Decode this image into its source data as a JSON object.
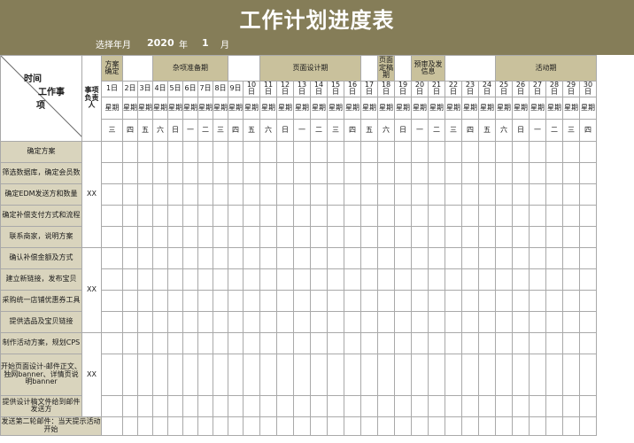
{
  "title": "工作计划进度表",
  "select_label": "选择年月",
  "year_value": "2020",
  "year_unit": "年",
  "month_value": "1",
  "month_unit": "月",
  "corner": {
    "line1": "时间",
    "line2": "工作事",
    "line3": "项"
  },
  "owner_header": "事项负责人",
  "phases": [
    {
      "label": "方案确定",
      "span": 1,
      "shaded": true
    },
    {
      "label": "",
      "span": 2,
      "shaded": false
    },
    {
      "label": "杂项准备期",
      "span": 5,
      "shaded": true
    },
    {
      "label": "",
      "span": 2,
      "shaded": false
    },
    {
      "label": "页面设计期",
      "span": 6,
      "shaded": true
    },
    {
      "label": "",
      "span": 1,
      "shaded": false
    },
    {
      "label": "页面定稿期",
      "span": 1,
      "shaded": true
    },
    {
      "label": "",
      "span": 1,
      "shaded": false
    },
    {
      "label": "预审及发信息",
      "span": 2,
      "shaded": true
    },
    {
      "label": "",
      "span": 3,
      "shaded": false
    },
    {
      "label": "活动期",
      "span": 6,
      "shaded": true
    }
  ],
  "weekday_prefix": "星期",
  "days": [
    {
      "d": "1日",
      "w": "三"
    },
    {
      "d": "2日",
      "w": "四"
    },
    {
      "d": "3日",
      "w": "五"
    },
    {
      "d": "4日",
      "w": "六"
    },
    {
      "d": "5日",
      "w": "日"
    },
    {
      "d": "6日",
      "w": "一"
    },
    {
      "d": "7日",
      "w": "二"
    },
    {
      "d": "8日",
      "w": "三"
    },
    {
      "d": "9日",
      "w": "四"
    },
    {
      "d": "10日",
      "w": "五"
    },
    {
      "d": "11日",
      "w": "六"
    },
    {
      "d": "12日",
      "w": "日"
    },
    {
      "d": "13日",
      "w": "一"
    },
    {
      "d": "14日",
      "w": "二"
    },
    {
      "d": "15日",
      "w": "三"
    },
    {
      "d": "16日",
      "w": "四"
    },
    {
      "d": "17日",
      "w": "五"
    },
    {
      "d": "18日",
      "w": "六"
    },
    {
      "d": "19日",
      "w": "日"
    },
    {
      "d": "20日",
      "w": "一"
    },
    {
      "d": "21日",
      "w": "二"
    },
    {
      "d": "22日",
      "w": "三"
    },
    {
      "d": "23日",
      "w": "四"
    },
    {
      "d": "24日",
      "w": "五"
    },
    {
      "d": "25日",
      "w": "六"
    },
    {
      "d": "26日",
      "w": "日"
    },
    {
      "d": "27日",
      "w": "一"
    },
    {
      "d": "28日",
      "w": "二"
    },
    {
      "d": "29日",
      "w": "三"
    },
    {
      "d": "30日",
      "w": "四"
    }
  ],
  "groups": [
    {
      "owner": "XX",
      "tasks": [
        "确定方案",
        "筛选数据库，确定会员数",
        "确定EDM发送方和数量",
        "确定补偿支付方式和流程",
        "联系商家，说明方案"
      ]
    },
    {
      "owner": "XX",
      "tasks": [
        "确认补偿金额及方式",
        "建立新链接，发布宝贝",
        "采购统一店铺优惠券工具",
        "提供选品及宝贝链接"
      ]
    },
    {
      "owner": "XX",
      "tasks": [
        "制作活动方案，规划CPS",
        "开始页面设计-邮件正文、独网banner、详情页说明banner",
        "提供设计稿文件给到邮件发送方"
      ]
    }
  ],
  "footer": "发送第二轮邮件：当天提示活动开始",
  "colors": {
    "banner": "#857d58",
    "phase": "#c9c19c",
    "task": "#d9d4bd"
  }
}
